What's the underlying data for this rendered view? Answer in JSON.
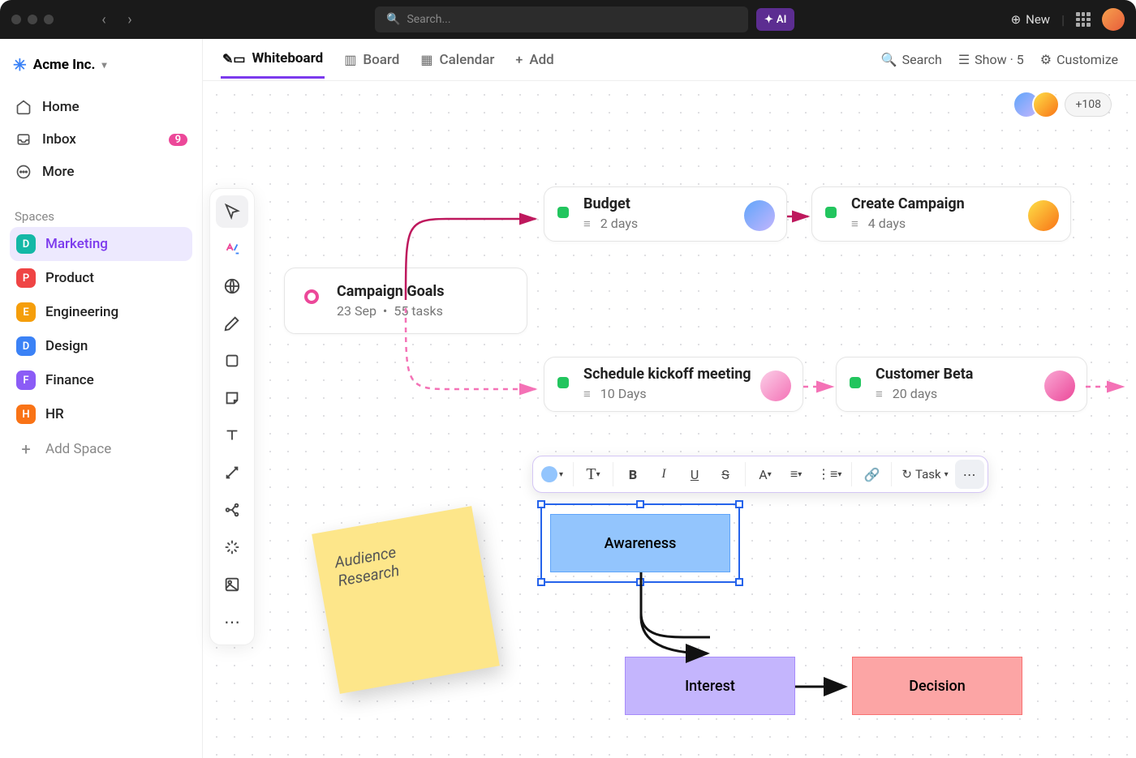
{
  "titlebar": {
    "search_placeholder": "Search...",
    "ai": "AI",
    "new_label": "New"
  },
  "workspace": {
    "name": "Acme Inc."
  },
  "nav": {
    "home": "Home",
    "inbox": "Inbox",
    "inbox_badge": "9",
    "more": "More"
  },
  "spaces_header": "Spaces",
  "spaces": [
    {
      "letter": "D",
      "label": "Marketing",
      "color": "#14b8a6",
      "active": true
    },
    {
      "letter": "P",
      "label": "Product",
      "color": "#ef4444"
    },
    {
      "letter": "E",
      "label": "Engineering",
      "color": "#f59e0b"
    },
    {
      "letter": "D",
      "label": "Design",
      "color": "#3b82f6"
    },
    {
      "letter": "F",
      "label": "Finance",
      "color": "#8b5cf6"
    },
    {
      "letter": "H",
      "label": "HR",
      "color": "#f97316"
    }
  ],
  "add_space": "Add Space",
  "tabs": {
    "whiteboard": "Whiteboard",
    "board": "Board",
    "calendar": "Calendar",
    "add": "Add"
  },
  "tabbar_right": {
    "search": "Search",
    "show": "Show · 5",
    "customize": "Customize"
  },
  "collaborators_extra": "+108",
  "goal_card": {
    "title": "Campaign Goals",
    "date": "23 Sep",
    "tasks": "55 tasks"
  },
  "tcard1": {
    "title": "Budget",
    "meta": "2 days"
  },
  "tcard2": {
    "title": "Create Campaign",
    "meta": "4 days"
  },
  "tcard3": {
    "title": "Schedule kickoff meeting",
    "meta": "10 Days"
  },
  "tcard4": {
    "title": "Customer Beta",
    "meta": "20 days"
  },
  "sticky": "Audience Research",
  "flow": {
    "awareness": "Awareness",
    "interest": "Interest",
    "decision": "Decision"
  },
  "float_toolbar": {
    "task": "Task"
  },
  "avatar_colors": {
    "a1": "linear-gradient(135deg,#f9a8d4,#fb923c)",
    "a2": "linear-gradient(135deg,#fde047,#f97316)",
    "a3": "linear-gradient(135deg,#60a5fa,#c4b5fd)",
    "a4": "linear-gradient(135deg,#fbcfe8,#f472b6)",
    "a5": "linear-gradient(135deg,#f9a8d4,#ec4899)"
  }
}
